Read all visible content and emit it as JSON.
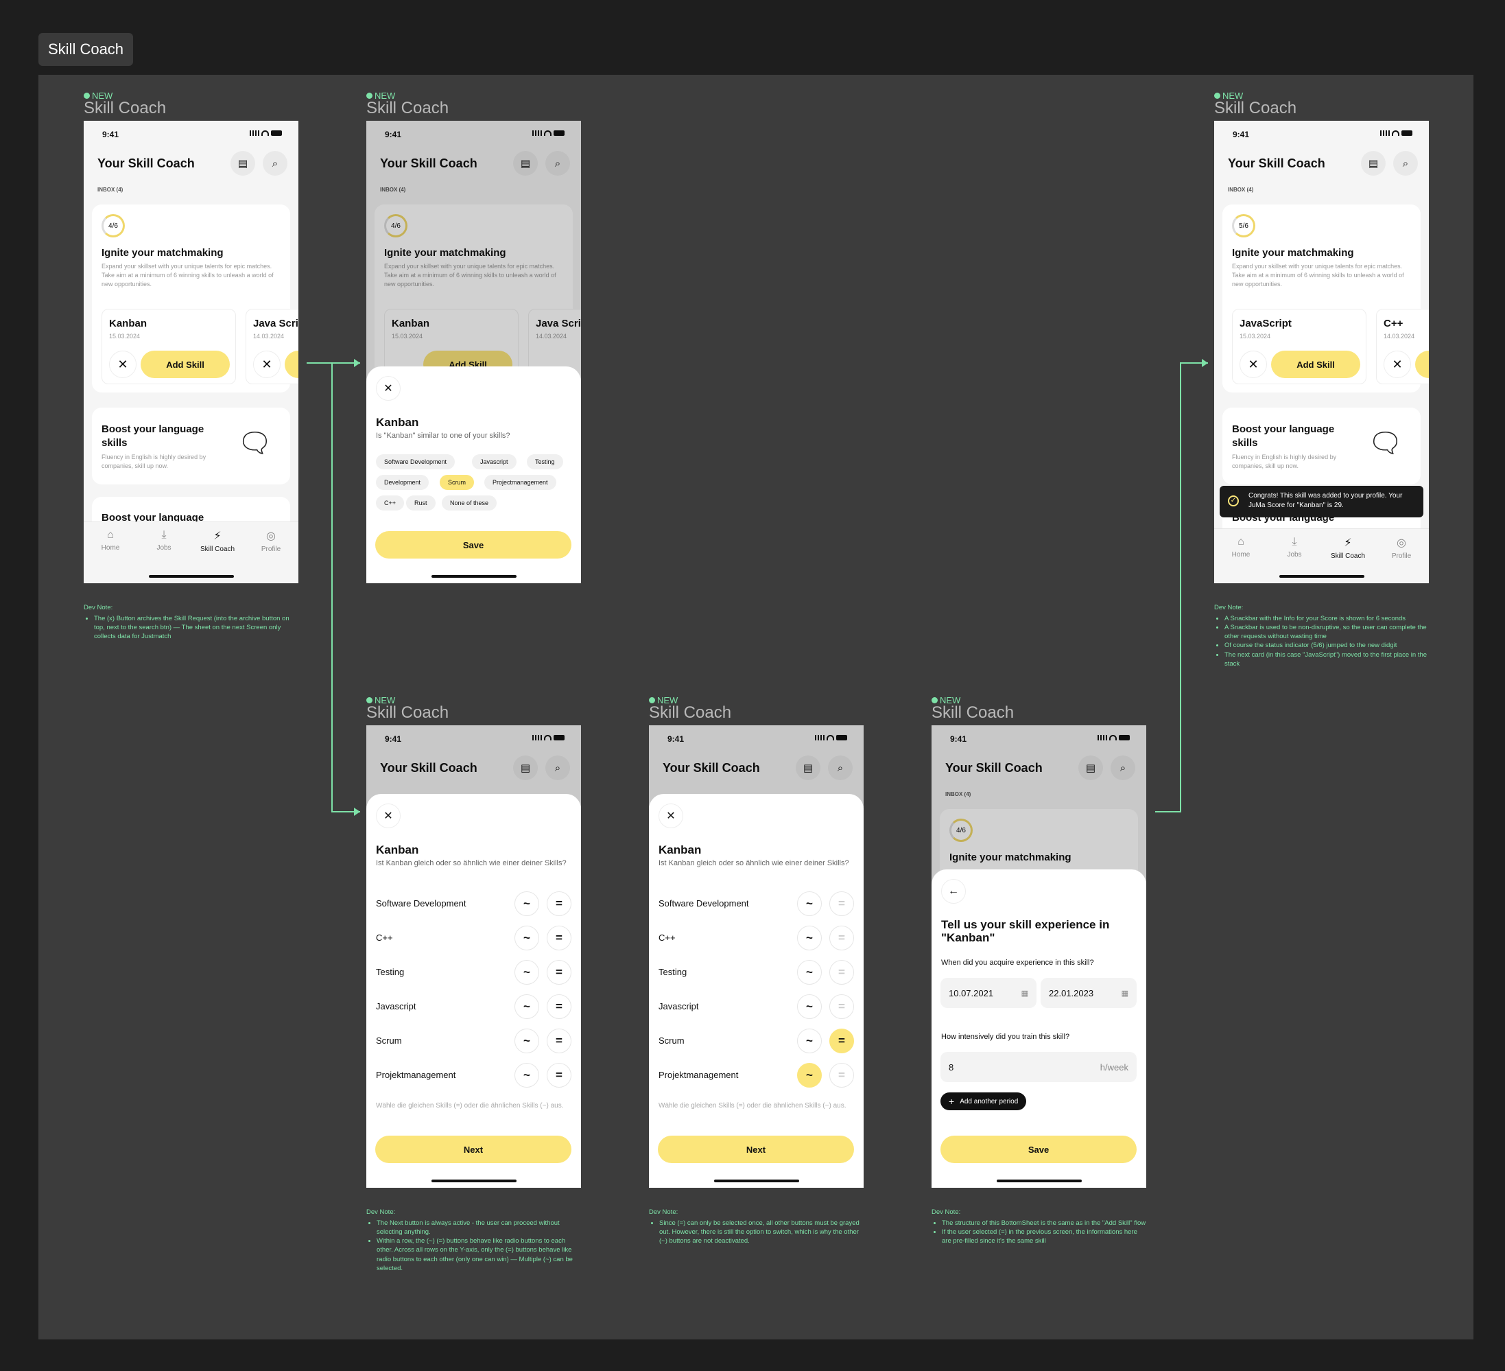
{
  "page_tag": "Skill Coach",
  "frame_label": "Skill Coach",
  "new_badge": "NEW",
  "status_time": "9:41",
  "header_title": "Your Skill Coach",
  "inbox_label": "INBOX (4)",
  "nav": {
    "home": "Home",
    "jobs": "Jobs",
    "coach": "Skill Coach",
    "profile": "Profile"
  },
  "match_card": {
    "title": "Ignite your matchmaking",
    "desc": "Expand your skillset with your unique talents for epic matches. Take aim at a minimum of 6 winning skills to unleash a world of new opportunities.",
    "progress_a": "4/6",
    "progress_b": "5/6"
  },
  "skills": {
    "kanban": "Kanban",
    "kanban_date": "15.03.2024",
    "java": "Java Script",
    "java_date": "14.03.2024",
    "javascript": "JavaScript",
    "javascript_date": "15.03.2024",
    "cpp": "C++",
    "cpp_date": "14.03.2024",
    "add": "Add Skill"
  },
  "boost": {
    "title": "Boost your language skills",
    "desc": "Fluency in English is highly desired by companies, skill up now.",
    "title_short": "Boost your language"
  },
  "sheet1": {
    "title": "Kanban",
    "question": "Is \"Kanban\" similar to one of your skills?",
    "chips": [
      "Software Development",
      "Javascript",
      "Testing",
      "Development",
      "Scrum",
      "Projectmanagement",
      "C++",
      "Rust",
      "None of these"
    ],
    "save": "Save"
  },
  "sheet2": {
    "title": "Kanban",
    "question": "Ist Kanban gleich oder so ähnlich wie einer deiner Skills?",
    "rows": [
      "Software Development",
      "C++",
      "Testing",
      "Javascript",
      "Scrum",
      "Projektmanagement"
    ],
    "sim": "~",
    "eq": "=",
    "hint": "Wähle die gleichen Skills (=) oder die ähnlichen Skills (~) aus.",
    "next": "Next"
  },
  "sheet3": {
    "title": "Tell us your skill experience in \"Kanban\"",
    "q1": "When did you acquire experience in this skill?",
    "from": "10.07.2021",
    "to": "22.01.2023",
    "q2": "How intensively did you train this skill?",
    "hours": "8",
    "unit": "h/week",
    "add_period": "Add another period",
    "save": "Save"
  },
  "snackbar": "Congrats! This skill was added to your profile. Your JuMa Score for \"Kanban\" is 29.",
  "notes": {
    "title": "Dev Note:",
    "n1": [
      "The (x) Button archives the Skill Request (into the archive button on top, next to the search btn) — The sheet on the next Screen only collects data for Justmatch"
    ],
    "n2": [
      "A Snackbar with the Info for your Score is shown for 6 seconds",
      "A Snackbar is used to be non-disruptive, so the user can complete the other requests without wasting time",
      "Of course the status indicator (5/6) jumped to the new didgit",
      "The next card (in this case \"JavaScript\") moved to the first place in the stack"
    ],
    "n3": [
      "The Next button is always active - the user can proceed without selecting anything.",
      "Within a row, the (~) (=) buttons behave like radio buttons to each other. Across all rows on the Y-axis, only the (=) buttons behave like radio buttons to each other (only one can win) — Multiple (~) can be selected."
    ],
    "n4": [
      "Since (=) can only be selected once, all other buttons must be grayed out. However, there is still the option to switch, which is why the other (~) buttons are not deactivated."
    ],
    "n5": [
      "The structure of this BottomSheet is the same as in the \"Add Skill\" flow",
      "If the user selected (=) in the previous screen, the informations here are pre-filled since it's the same skill"
    ]
  },
  "colors": {
    "accent": "#fbe57a",
    "note": "#7ee2a8",
    "canvas": "#3c3c3c"
  }
}
